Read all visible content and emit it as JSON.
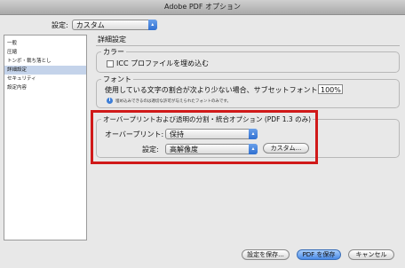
{
  "window": {
    "title": "Adobe PDF オプション"
  },
  "preset": {
    "label": "設定:",
    "value": "カスタム"
  },
  "sidebar": {
    "items": [
      {
        "label": "一般"
      },
      {
        "label": "圧縮"
      },
      {
        "label": "トンボ・裁ち落とし"
      },
      {
        "label": "詳細設定"
      },
      {
        "label": "セキュリティ"
      },
      {
        "label": "設定内容"
      }
    ]
  },
  "panel": {
    "title": "詳細設定"
  },
  "color_group": {
    "title": "カラー",
    "icc_checkbox_label": "ICC プロファイルを埋め込む",
    "icc_checked": false
  },
  "font_group": {
    "title": "フォント",
    "subset_label": "使用している文字の割合が次より少ない場合、サブセットフォントにする:",
    "subset_value": "100%",
    "note": "埋め込みできるのは適切な許可が与えられたフォントのみです。"
  },
  "overprint_group": {
    "title": "オーバープリントおよび透明の分割・統合オプション (PDF 1.3 のみ)",
    "overprint_label": "オーバープリント:",
    "overprint_value": "保持",
    "setting_label": "設定:",
    "setting_value": "高解像度",
    "custom_button": "カスタム..."
  },
  "footer": {
    "save_settings": "設定を保存...",
    "save_pdf": "PDF を保存",
    "cancel": "キャンセル"
  },
  "colors": {
    "highlight": "#d01919",
    "accent": "#3b7fe0"
  }
}
